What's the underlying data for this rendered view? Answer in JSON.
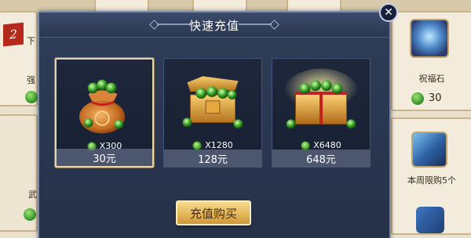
{
  "dialog": {
    "title": "快速充值",
    "buy_label": "充值购买"
  },
  "packs": [
    {
      "gems": "X300",
      "price": "30元",
      "selected": true
    },
    {
      "gems": "X1280",
      "price": "128元",
      "selected": false
    },
    {
      "gems": "X6480",
      "price": "648元",
      "selected": false
    }
  ],
  "background": {
    "badge_number": "2",
    "left_fragments": [
      "下",
      "强",
      "武"
    ],
    "right_items": [
      {
        "name": "祝福石",
        "price": "30"
      },
      {
        "name": "本周限购5个",
        "price": ""
      }
    ]
  },
  "icons": {
    "close": "close-icon",
    "currency": "jade-gem-icon"
  },
  "colors": {
    "modal_bg": "#2b3853",
    "buy_button": "#e4b85a",
    "selected_border": "#e6d6ae"
  }
}
